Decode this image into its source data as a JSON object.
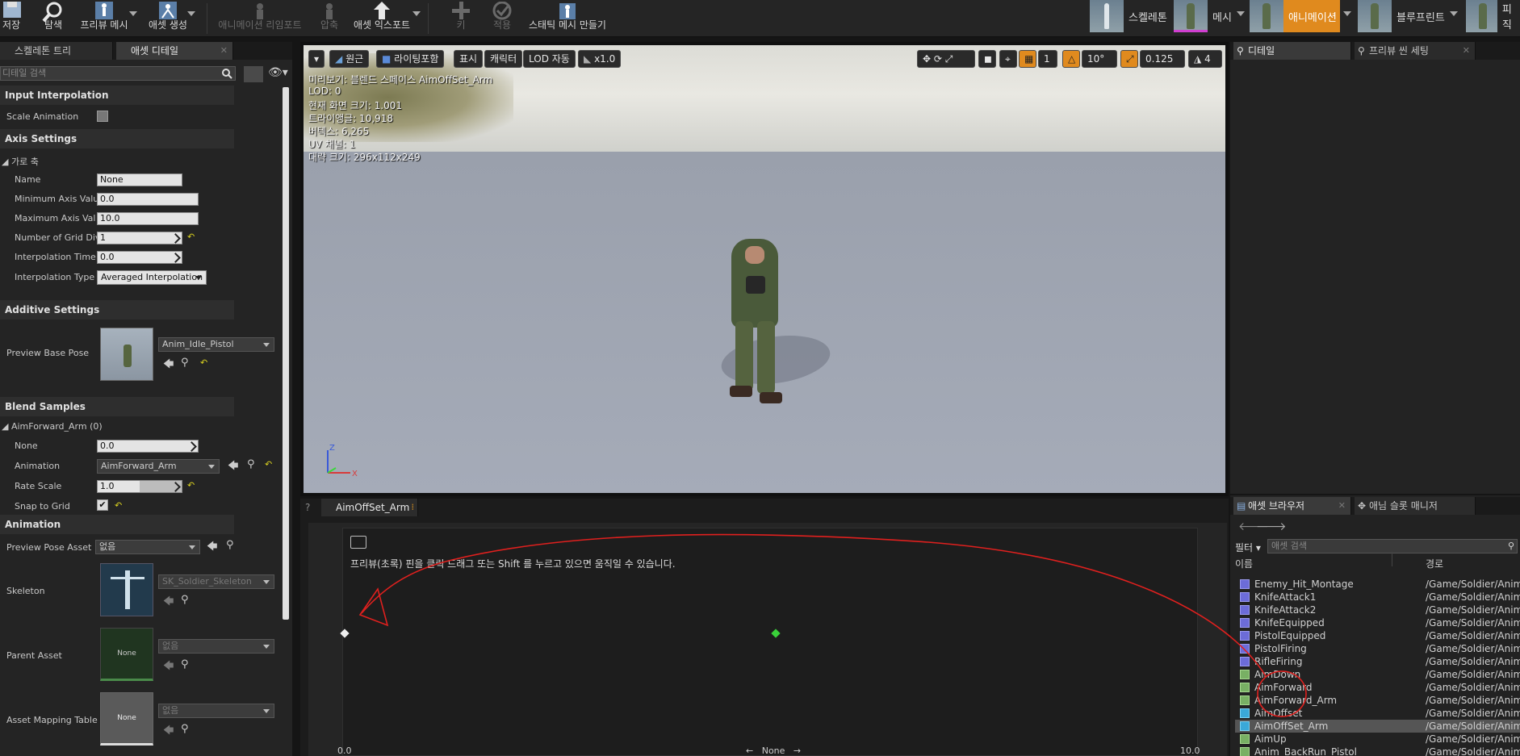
{
  "toolbar": {
    "buttons": [
      {
        "label": "저장",
        "icon": "save-icon"
      },
      {
        "label": "탐색",
        "icon": "browse-icon"
      },
      {
        "label": "프리뷰 메시",
        "icon": "preview-mesh-icon"
      },
      {
        "label": "애셋 생성",
        "icon": "create-asset-icon"
      },
      {
        "label": "애니메이션 리임포트",
        "icon": "reimport-icon"
      },
      {
        "label": "압축",
        "icon": "compress-icon"
      },
      {
        "label": "애셋 익스포트",
        "icon": "export-icon"
      },
      {
        "label": "키",
        "icon": "add-key-icon"
      },
      {
        "label": "적용",
        "icon": "apply-icon"
      },
      {
        "label": "스태틱 메시 만들기",
        "icon": "static-mesh-icon"
      }
    ],
    "modes": [
      {
        "label": "스켈레톤"
      },
      {
        "label": "메시"
      },
      {
        "label": "애니메이션"
      },
      {
        "label": "블루프린트"
      },
      {
        "label": "피직"
      }
    ]
  },
  "left_panel": {
    "tabs": [
      "스켈레톤 트리",
      "애셋 디테일"
    ],
    "search_placeholder": "디테일 검색",
    "sections": {
      "input_interpolation": "Input Interpolation",
      "axis_settings": "Axis Settings",
      "additive_settings": "Additive Settings",
      "blend_samples": "Blend Samples",
      "animation": "Animation"
    },
    "scale_animation_label": "Scale Animation",
    "horizontal_axis_label": "가로 축",
    "axis_rows": {
      "name_label": "Name",
      "name_value": "None",
      "min_label": "Minimum Axis Valu",
      "min_value": "0.0",
      "max_label": "Maximum Axis Val",
      "max_value": "10.0",
      "grid_label": "Number of Grid Divi",
      "grid_value": "1",
      "interp_time_label": "Interpolation Time",
      "interp_time_value": "0.0",
      "interp_type_label": "Interpolation Type",
      "interp_type_value": "Averaged Interpolation"
    },
    "preview_base_pose_label": "Preview Base Pose",
    "preview_base_pose_value": "Anim_Idle_Pistol",
    "sample_header": "AimForward_Arm (0)",
    "sample_rows": {
      "none_label": "None",
      "none_value": "0.0",
      "animation_label": "Animation",
      "animation_value": "AimForward_Arm",
      "rate_label": "Rate Scale",
      "rate_value": "1.0",
      "snap_label": "Snap to Grid"
    },
    "animation_rows": {
      "preview_pose_label": "Preview Pose Asset",
      "preview_pose_value": "없음",
      "skeleton_label": "Skeleton",
      "skeleton_value": "SK_Soldier_Skeleton",
      "parent_label": "Parent Asset",
      "parent_value": "없음",
      "parent_thumb": "None",
      "mapping_label": "Asset Mapping Table",
      "mapping_value": "없음",
      "mapping_thumb": "None"
    }
  },
  "viewport": {
    "buttons": [
      "원근",
      "라이팅포함",
      "표시",
      "캐릭터",
      "LOD 자동",
      "x1.0"
    ],
    "right_buttons": {
      "angle": "10°",
      "scale": "0.125",
      "speed": "4",
      "count": "1"
    },
    "stats": [
      "미리보기: 블렌드 스페이스 AimOffSet_Arm",
      "LOD: 0",
      "현재 화면 크기: 1.001",
      "트라이앵글: 10,918",
      "버텍스: 6,265",
      "UV 채널: 1",
      "대략 크기: 296x112x249"
    ]
  },
  "blend_editor": {
    "tab": "AimOffSet_Arm",
    "hint": "프리뷰(초록) 핀을 클릭 드래그 또는 Shift 를 누르고 있으면 움직일 수 있습니다.",
    "x_min": "0.0",
    "x_max": "10.0",
    "axis_name": "None",
    "arrow_left": "←",
    "arrow_right": "→"
  },
  "right_panel": {
    "tabs": [
      "디테일",
      "프리뷰 씬 세팅"
    ],
    "bottom_tabs": [
      "애셋 브라우저",
      "애님 슬롯 매니저"
    ],
    "filter_label": "필터",
    "search_placeholder": "애셋 검색",
    "columns": {
      "name": "이름",
      "path": "경로"
    },
    "assets": [
      {
        "name": "Enemy_Hit_Montage",
        "path": "/Game/Soldier/Anima"
      },
      {
        "name": "KnifeAttack1",
        "path": "/Game/Soldier/Anima"
      },
      {
        "name": "KnifeAttack2",
        "path": "/Game/Soldier/Anima"
      },
      {
        "name": "KnifeEquipped",
        "path": "/Game/Soldier/Anima"
      },
      {
        "name": "PistolEquipped",
        "path": "/Game/Soldier/Anima"
      },
      {
        "name": "PistolFiring",
        "path": "/Game/Soldier/Anima"
      },
      {
        "name": "RifleFiring",
        "path": "/Game/Soldier/Anima"
      },
      {
        "name": "AimDown",
        "path": "/Game/Soldier/Anima"
      },
      {
        "name": "AimForward",
        "path": "/Game/Soldier/Anima"
      },
      {
        "name": "AimForward_Arm",
        "path": "/Game/Soldier/Anima"
      },
      {
        "name": "AimOffset",
        "path": "/Game/Soldier/Anima"
      },
      {
        "name": "AimOffSet_Arm",
        "path": "/Game/Soldier/Anima"
      },
      {
        "name": "AimUp",
        "path": "/Game/Soldier/Anima"
      },
      {
        "name": "Anim_BackRun_Pistol",
        "path": "/Game/Soldier/Anima"
      }
    ]
  },
  "colors": {
    "accent_orange": "#e08a1e",
    "annotation_red": "#e0201e",
    "preview_pin": "#3ad13a"
  }
}
